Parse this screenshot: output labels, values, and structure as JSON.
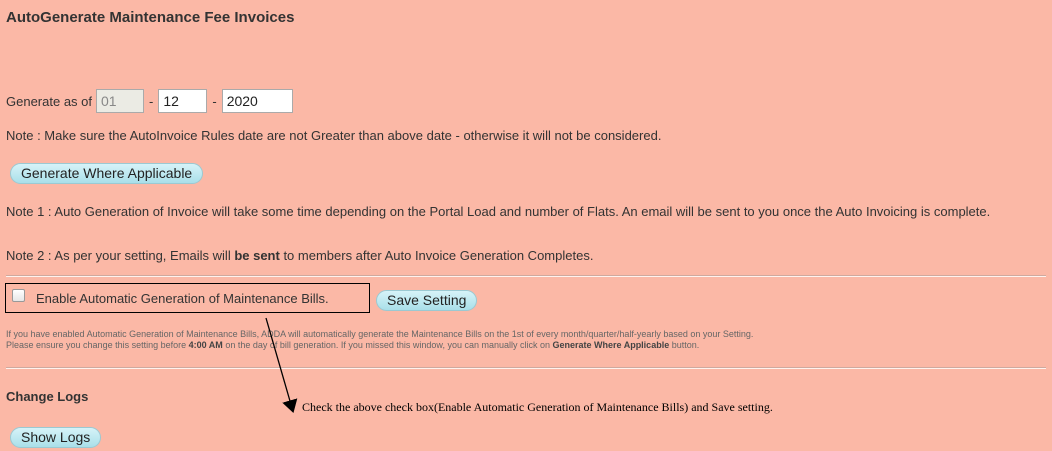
{
  "title": "AutoGenerate Maintenance Fee Invoices",
  "generate": {
    "label": "Generate as of",
    "day": "01",
    "month": "12",
    "year": "2020",
    "separator": "-"
  },
  "note_rules": "Note : Make sure the AutoInvoice Rules date are not Greater than above date - otherwise it will not be considered.",
  "generate_button": "Generate Where Applicable",
  "note1": "Note 1 : Auto Generation of Invoice will take some time depending on the Portal Load and number of Flats. An email will be sent to you once the Auto Invoicing is complete.",
  "note2": {
    "prefix": "Note 2 : As per your setting, Emails will ",
    "bold": "be sent",
    "suffix": " to members after Auto Invoice Generation Completes."
  },
  "auto_bills": {
    "checkbox_label": "Enable Automatic Generation of Maintenance Bills.",
    "checked": false,
    "save_button": "Save Setting"
  },
  "info": {
    "line1": "If you have enabled Automatic Generation of Maintenance Bills, ADDA will automatically generate the Maintenance Bills on the 1st of every month/quarter/half-yearly based on your Setting.",
    "line2_prefix": "Please ensure you change this setting before ",
    "line2_time": "4:00 AM",
    "line2_middle": " on the day of bill generation. If you missed this window, you can manually click on ",
    "line2_link": "Generate Where Applicable",
    "line2_suffix": " button."
  },
  "change_logs": {
    "title": "Change Logs",
    "button": "Show Logs"
  },
  "annotation": {
    "text": "Check the above check box(Enable Automatic Generation of Maintenance Bills) and Save setting."
  }
}
